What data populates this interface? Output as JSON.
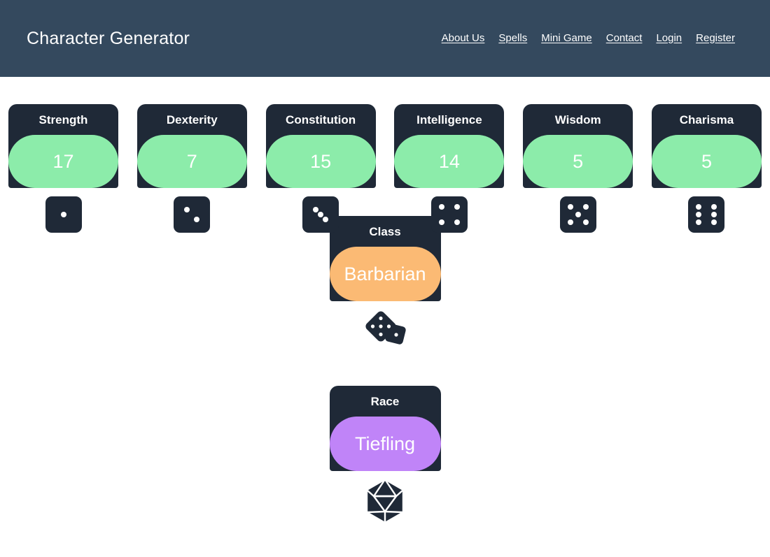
{
  "header": {
    "brand": "Character Generator",
    "nav": [
      {
        "label": "About Us"
      },
      {
        "label": "Spells"
      },
      {
        "label": "Mini Game"
      },
      {
        "label": "Contact"
      },
      {
        "label": "Login"
      },
      {
        "label": "Register"
      }
    ]
  },
  "colors": {
    "header_bg": "#34495e",
    "card_bg": "#1f2937",
    "page_bg": "#ffffff",
    "stat_pill": "#8cecaa",
    "class_pill": "#fbba74",
    "race_pill": "#c084f8",
    "text_light": "#ffffff"
  },
  "stats": [
    {
      "label": "Strength",
      "value": "17",
      "die_face": 1,
      "die_icon": "die-1-icon",
      "pill_color": "#8cecaa"
    },
    {
      "label": "Dexterity",
      "value": "7",
      "die_face": 2,
      "die_icon": "die-2-icon",
      "pill_color": "#8cecaa"
    },
    {
      "label": "Constitution",
      "value": "15",
      "die_face": 3,
      "die_icon": "die-3-icon",
      "pill_color": "#8cecaa"
    },
    {
      "label": "Intelligence",
      "value": "14",
      "die_face": 4,
      "die_icon": "die-4-icon",
      "pill_color": "#8cecaa"
    },
    {
      "label": "Wisdom",
      "value": "5",
      "die_face": 5,
      "die_icon": "die-5-icon",
      "pill_color": "#8cecaa"
    },
    {
      "label": "Charisma",
      "value": "5",
      "die_face": 6,
      "die_icon": "die-6-icon",
      "pill_color": "#8cecaa"
    }
  ],
  "class_card": {
    "label": "Class",
    "value": "Barbarian",
    "icon": "two-dice-icon",
    "pill_color": "#fbba74"
  },
  "race_card": {
    "label": "Race",
    "value": "Tiefling",
    "icon": "d20-icon",
    "pill_color": "#c084f8"
  }
}
